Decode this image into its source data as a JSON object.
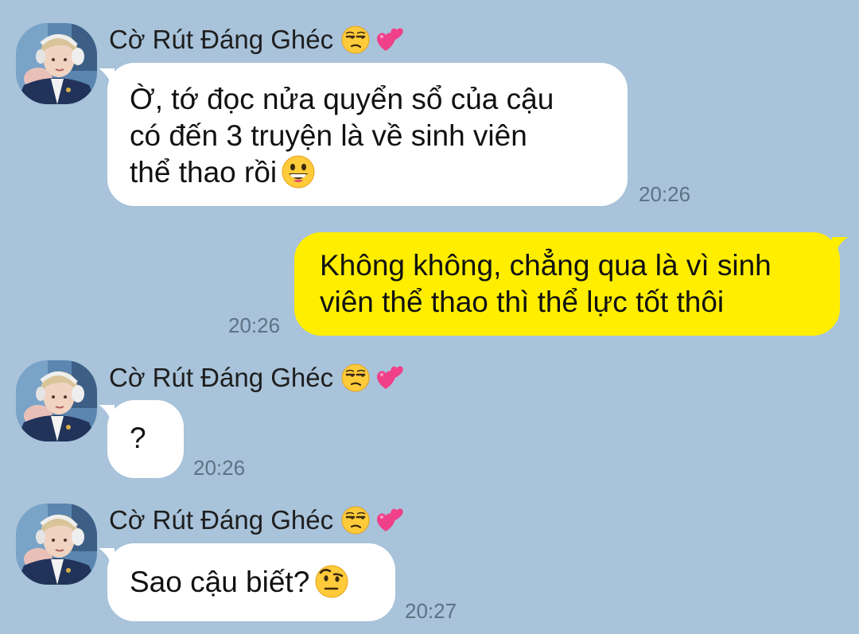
{
  "chat": {
    "contact_name": "Cờ Rút Đáng Ghéc",
    "contact_name_icons": [
      "unamused-face-icon",
      "two-hearts-icon"
    ],
    "messages": [
      {
        "direction": "incoming",
        "lines": [
          "Ờ, tớ đọc nửa quyển sổ của cậu",
          "có đến 3 truyện là về sinh viên",
          "thể thao rồi"
        ],
        "emoji": "grinning-face-icon",
        "time": "20:26"
      },
      {
        "direction": "outgoing",
        "lines": [
          "Không không, chẳng qua là vì sinh",
          "viên thể thao thì thể lực tốt thôi"
        ],
        "time": "20:26"
      },
      {
        "direction": "incoming",
        "lines": [
          "?"
        ],
        "time": "20:26"
      },
      {
        "direction": "incoming",
        "lines": [
          "Sao cậu biết?"
        ],
        "emoji": "face-with-raised-eyebrow-icon",
        "time": "20:27"
      }
    ]
  },
  "colors": {
    "background": "#a8c3da",
    "incoming_bubble": "#ffffff",
    "outgoing_bubble": "#ffee00",
    "timestamp": "#5e7284"
  }
}
